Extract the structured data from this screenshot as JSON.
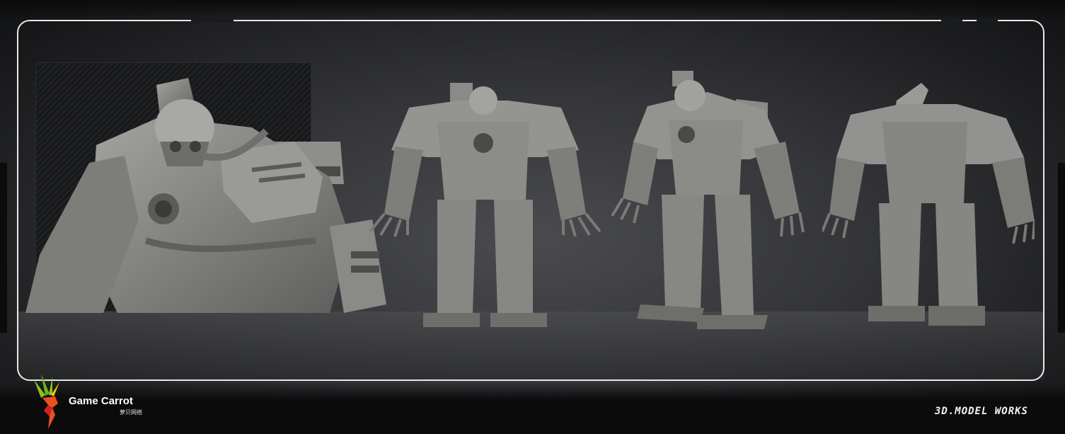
{
  "logo": {
    "name": "Game Carrot",
    "subtitle": "萝贝网络",
    "colors": {
      "green": "#8fc31f",
      "yellow": "#f5c400",
      "orange": "#e8501e",
      "red": "#d21f1f"
    }
  },
  "caption": "3D.MODEL WORKS",
  "renders": [
    {
      "view": "close-up"
    },
    {
      "view": "front"
    },
    {
      "view": "three-quarter"
    },
    {
      "view": "back"
    }
  ],
  "colors": {
    "background": "#333437",
    "frame": "#e8e8e8",
    "model": "#8a8a88"
  }
}
